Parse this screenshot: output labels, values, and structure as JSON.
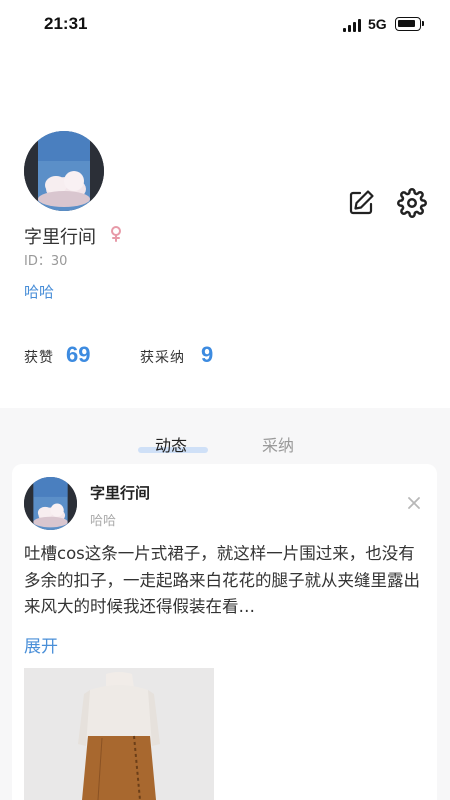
{
  "status_bar": {
    "time": "21:31",
    "network": "5G"
  },
  "profile": {
    "name": "字里行间",
    "gender": "♀",
    "id": "ID：30",
    "bio": "哈哈",
    "stats": [
      {
        "label": "获赞",
        "value": "69"
      },
      {
        "label": "获采纳",
        "value": "9"
      }
    ]
  },
  "tabs": [
    {
      "label": "动态",
      "active": true
    },
    {
      "label": "采纳",
      "active": false
    }
  ],
  "post": {
    "author": "字里行间",
    "subtitle": "哈哈",
    "text": "吐槽cos这条一片式裙子，就这样一片围过来，也没有多余的扣子，一走起路来白花花的腿子就从夹缝里露出来风大的时候我还得假装在看…",
    "expand_label": "展开"
  },
  "colors": {
    "accent": "#3d8be0",
    "link": "#4a8fd8",
    "gender": "#e79aa8",
    "tab_indicator": "#cfe0f7"
  },
  "icons": [
    "edit-icon",
    "settings-icon",
    "female-icon",
    "close-icon"
  ]
}
